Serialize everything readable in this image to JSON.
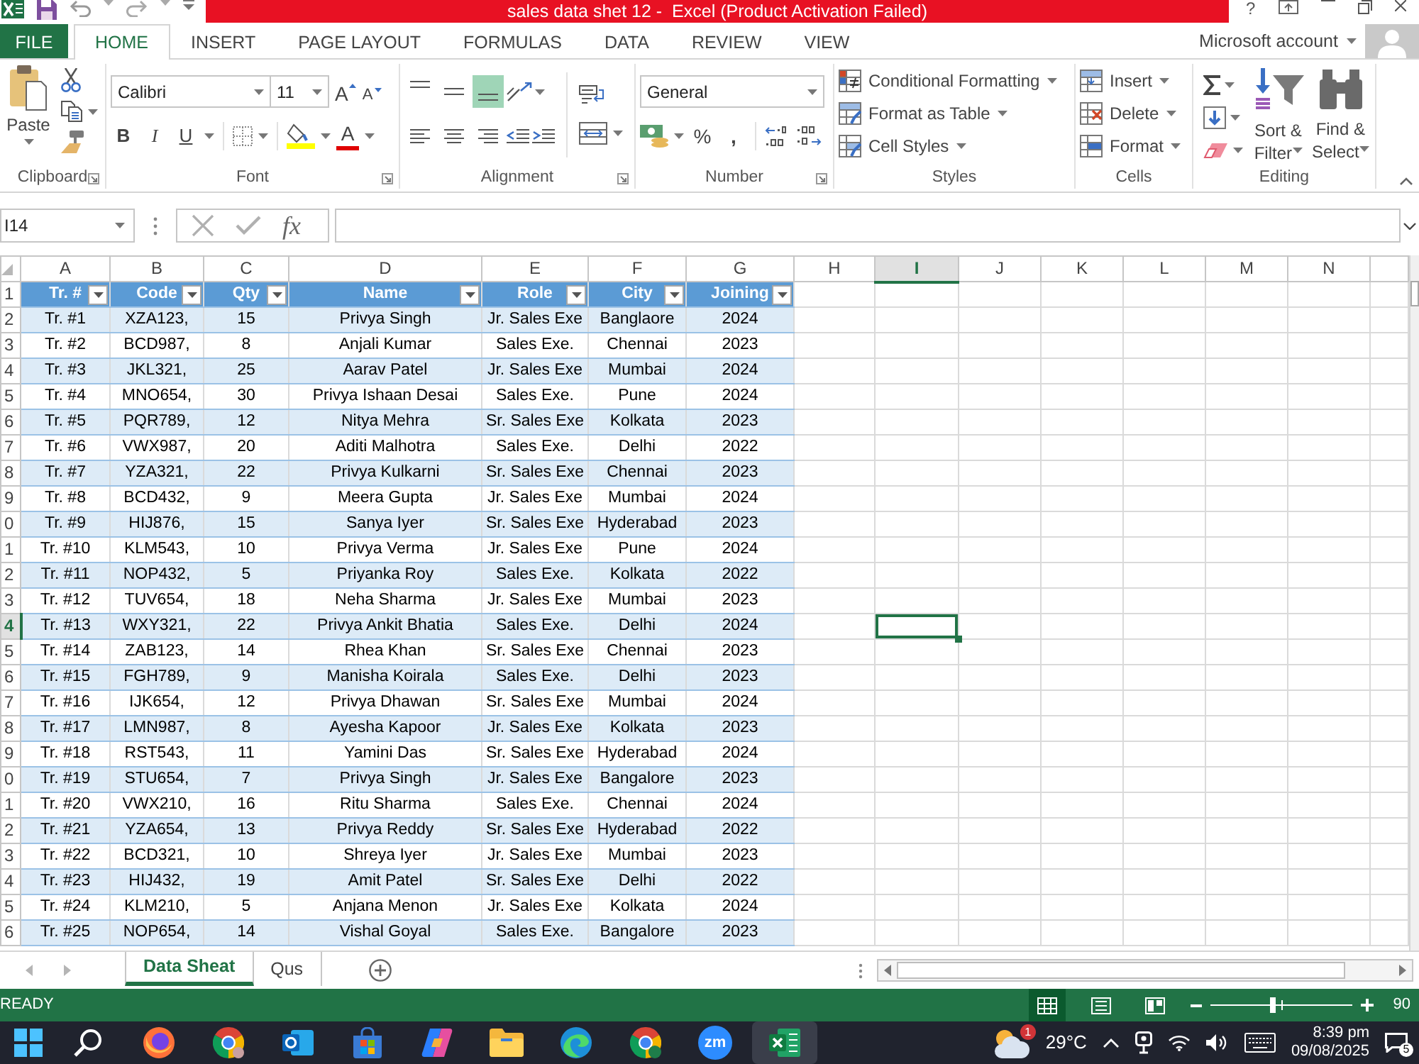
{
  "title_bar": {
    "title": "sales data shet 12 -  Excel (Product Activation Failed)",
    "help": "?"
  },
  "tabs": [
    {
      "label": "FILE",
      "kind": "backstage",
      "selected": false
    },
    {
      "label": "HOME",
      "kind": "tab",
      "selected": true
    },
    {
      "label": "INSERT",
      "kind": "tab",
      "selected": false
    },
    {
      "label": "PAGE LAYOUT",
      "kind": "tab",
      "selected": false
    },
    {
      "label": "FORMULAS",
      "kind": "tab",
      "selected": false
    },
    {
      "label": "DATA",
      "kind": "tab",
      "selected": false
    },
    {
      "label": "REVIEW",
      "kind": "tab",
      "selected": false
    },
    {
      "label": "VIEW",
      "kind": "tab",
      "selected": false
    }
  ],
  "account": {
    "label": "Microsoft account"
  },
  "ribbon": {
    "clipboard": {
      "label": "Clipboard",
      "paste": "Paste"
    },
    "font": {
      "label": "Font",
      "font_name": "Calibri",
      "font_size": "11",
      "grow": "A",
      "shrink": "A",
      "bold": "B",
      "italic": "I",
      "underline": "U",
      "font_color": "A"
    },
    "alignment": {
      "label": "Alignment",
      "vertical": [
        {
          "kind": "top",
          "selected": false
        },
        {
          "kind": "middle",
          "selected": false
        },
        {
          "kind": "bottom",
          "selected": true
        }
      ],
      "horizontal": [
        {
          "kind": "left",
          "selected": false
        },
        {
          "kind": "center",
          "selected": false
        },
        {
          "kind": "right",
          "selected": false
        }
      ]
    },
    "number": {
      "label": "Number",
      "format": "General",
      "percent": "%",
      "comma": ","
    },
    "styles": {
      "label": "Styles",
      "buttons": [
        {
          "kind": "conditional",
          "label": "Conditional Formatting"
        },
        {
          "kind": "table",
          "label": "Format as Table"
        },
        {
          "kind": "cell",
          "label": "Cell Styles"
        }
      ]
    },
    "cells": {
      "label": "Cells",
      "buttons": [
        {
          "kind": "insert",
          "label": "Insert"
        },
        {
          "kind": "delete",
          "label": "Delete"
        },
        {
          "kind": "format",
          "label": "Format"
        }
      ]
    },
    "editing": {
      "label": "Editing",
      "sort": "Sort & Filter",
      "find": "Find & Select"
    }
  },
  "formula_bar": {
    "name_box": "I14",
    "fx": "fx"
  },
  "grid": {
    "columns": [
      {
        "label": "A",
        "selected": false
      },
      {
        "label": "B",
        "selected": false
      },
      {
        "label": "C",
        "selected": false
      },
      {
        "label": "D",
        "selected": false
      },
      {
        "label": "E",
        "selected": false
      },
      {
        "label": "F",
        "selected": false
      },
      {
        "label": "G",
        "selected": false
      },
      {
        "label": "H",
        "selected": false
      },
      {
        "label": "I",
        "selected": true
      },
      {
        "label": "J",
        "selected": false
      },
      {
        "label": "K",
        "selected": false
      },
      {
        "label": "L",
        "selected": false
      },
      {
        "label": "M",
        "selected": false
      },
      {
        "label": "N",
        "selected": false
      }
    ],
    "rows": [
      {
        "label": "1",
        "selected": false
      },
      {
        "label": "2",
        "selected": false
      },
      {
        "label": "3",
        "selected": false
      },
      {
        "label": "4",
        "selected": false
      },
      {
        "label": "5",
        "selected": false
      },
      {
        "label": "6",
        "selected": false
      },
      {
        "label": "7",
        "selected": false
      },
      {
        "label": "8",
        "selected": false
      },
      {
        "label": "9",
        "selected": false
      },
      {
        "label": "0",
        "selected": false
      },
      {
        "label": "1",
        "selected": false
      },
      {
        "label": "2",
        "selected": false
      },
      {
        "label": "3",
        "selected": false
      },
      {
        "label": "4",
        "selected": true
      },
      {
        "label": "5",
        "selected": false
      },
      {
        "label": "6",
        "selected": false
      },
      {
        "label": "7",
        "selected": false
      },
      {
        "label": "8",
        "selected": false
      },
      {
        "label": "9",
        "selected": false
      },
      {
        "label": "0",
        "selected": false
      },
      {
        "label": "1",
        "selected": false
      },
      {
        "label": "2",
        "selected": false
      },
      {
        "label": "3",
        "selected": false
      },
      {
        "label": "4",
        "selected": false
      },
      {
        "label": "5",
        "selected": false
      },
      {
        "label": "6",
        "selected": false
      }
    ]
  },
  "table": {
    "columns": [
      "Tr. #",
      "Code",
      "Qty",
      "Name",
      "Role",
      "City",
      "Joining"
    ],
    "rows": [
      [
        "Tr. #1",
        "XZA123,",
        "15",
        "Privya Singh",
        "Jr. Sales Exe",
        "Banglaore",
        "2024"
      ],
      [
        "Tr. #2",
        "BCD987,",
        "8",
        "Anjali Kumar",
        "Sales Exe.",
        "Chennai",
        "2023"
      ],
      [
        "Tr. #3",
        "JKL321,",
        "25",
        "Aarav Patel",
        "Jr. Sales Exe",
        "Mumbai",
        "2024"
      ],
      [
        "Tr. #4",
        "MNO654,",
        "30",
        "Privya Ishaan Desai",
        "Sales Exe.",
        "Pune",
        "2024"
      ],
      [
        "Tr. #5",
        "PQR789,",
        "12",
        "Nitya Mehra",
        "Sr. Sales Exe",
        "Kolkata",
        "2023"
      ],
      [
        "Tr. #6",
        "VWX987,",
        "20",
        "Aditi Malhotra",
        "Sales Exe.",
        "Delhi",
        "2022"
      ],
      [
        "Tr. #7",
        "YZA321,",
        "22",
        "Privya Kulkarni",
        "Sr. Sales Exe",
        "Chennai",
        "2023"
      ],
      [
        "Tr. #8",
        "BCD432,",
        "9",
        "Meera Gupta",
        "Jr. Sales Exe",
        "Mumbai",
        "2024"
      ],
      [
        "Tr. #9",
        "HIJ876,",
        "15",
        "Sanya Iyer",
        "Sr. Sales Exe",
        "Hyderabad",
        "2023"
      ],
      [
        "Tr. #10",
        "KLM543,",
        "10",
        "Privya Verma",
        "Jr. Sales Exe",
        "Pune",
        "2024"
      ],
      [
        "Tr. #11",
        "NOP432,",
        "5",
        "Priyanka Roy",
        "Sales Exe.",
        "Kolkata",
        "2022"
      ],
      [
        "Tr. #12",
        "TUV654,",
        "18",
        "Neha Sharma",
        "Jr. Sales Exe",
        "Mumbai",
        "2023"
      ],
      [
        "Tr. #13",
        "WXY321,",
        "22",
        "Privya Ankit Bhatia",
        "Sales Exe.",
        "Delhi",
        "2024"
      ],
      [
        "Tr. #14",
        "ZAB123,",
        "14",
        "Rhea Khan",
        "Sr. Sales Exe",
        "Chennai",
        "2023"
      ],
      [
        "Tr. #15",
        "FGH789,",
        "9",
        "Manisha Koirala",
        "Sales Exe.",
        "Delhi",
        "2023"
      ],
      [
        "Tr. #16",
        "IJK654,",
        "12",
        "Privya Dhawan",
        "Sr. Sales Exe",
        "Mumbai",
        "2024"
      ],
      [
        "Tr. #17",
        "LMN987,",
        "8",
        "Ayesha Kapoor",
        "Jr. Sales Exe",
        "Kolkata",
        "2023"
      ],
      [
        "Tr. #18",
        "RST543,",
        "11",
        "Yamini Das",
        "Sr. Sales Exe",
        "Hyderabad",
        "2024"
      ],
      [
        "Tr. #19",
        "STU654,",
        "7",
        "Privya Singh",
        "Jr. Sales Exe",
        "Bangalore",
        "2023"
      ],
      [
        "Tr. #20",
        "VWX210,",
        "16",
        "Ritu Sharma",
        "Sales Exe.",
        "Chennai",
        "2024"
      ],
      [
        "Tr. #21",
        "YZA654,",
        "13",
        "Privya Reddy",
        "Sr. Sales Exe",
        "Hyderabad",
        "2022"
      ],
      [
        "Tr. #22",
        "BCD321,",
        "10",
        "Shreya Iyer",
        "Jr. Sales Exe",
        "Mumbai",
        "2023"
      ],
      [
        "Tr. #23",
        "HIJ432,",
        "19",
        "Amit Patel",
        "Sr. Sales Exe",
        "Delhi",
        "2022"
      ],
      [
        "Tr. #24",
        "KLM210,",
        "5",
        "Anjana Menon",
        "Jr. Sales Exe",
        "Kolkata",
        "2024"
      ],
      [
        "Tr. #25",
        "NOP654,",
        "14",
        "Vishal Goyal",
        "Sales Exe.",
        "Bangalore",
        "2023"
      ]
    ]
  },
  "sheet_tabs": [
    {
      "label": "Data Sheat",
      "selected": true
    },
    {
      "label": "Qus",
      "selected": false
    }
  ],
  "status_bar": {
    "mode": "READY",
    "views": [
      {
        "kind": "normal",
        "selected": true
      },
      {
        "kind": "page-layout",
        "selected": false
      },
      {
        "kind": "page-break",
        "selected": false
      }
    ],
    "zoom": {
      "level": 0.44,
      "reading": "90"
    }
  },
  "taskbar": {
    "apps": [
      {
        "kind": "start",
        "selected": false
      },
      {
        "kind": "search",
        "selected": false
      },
      {
        "kind": "firefox",
        "selected": false
      },
      {
        "kind": "chrome",
        "selected": false
      },
      {
        "kind": "outlook",
        "selected": false
      },
      {
        "kind": "store",
        "selected": false
      },
      {
        "kind": "copilot",
        "selected": false
      },
      {
        "kind": "explorer",
        "selected": false
      },
      {
        "kind": "edge",
        "selected": false
      },
      {
        "kind": "chrome-profile",
        "selected": false
      },
      {
        "kind": "zoom",
        "label": "zm",
        "selected": false
      },
      {
        "kind": "excel",
        "selected": true
      }
    ],
    "weather": {
      "temperature": "29°C",
      "badge": "1"
    },
    "time": "8:39 pm",
    "date": "09/08/2025",
    "notifications": "5"
  }
}
